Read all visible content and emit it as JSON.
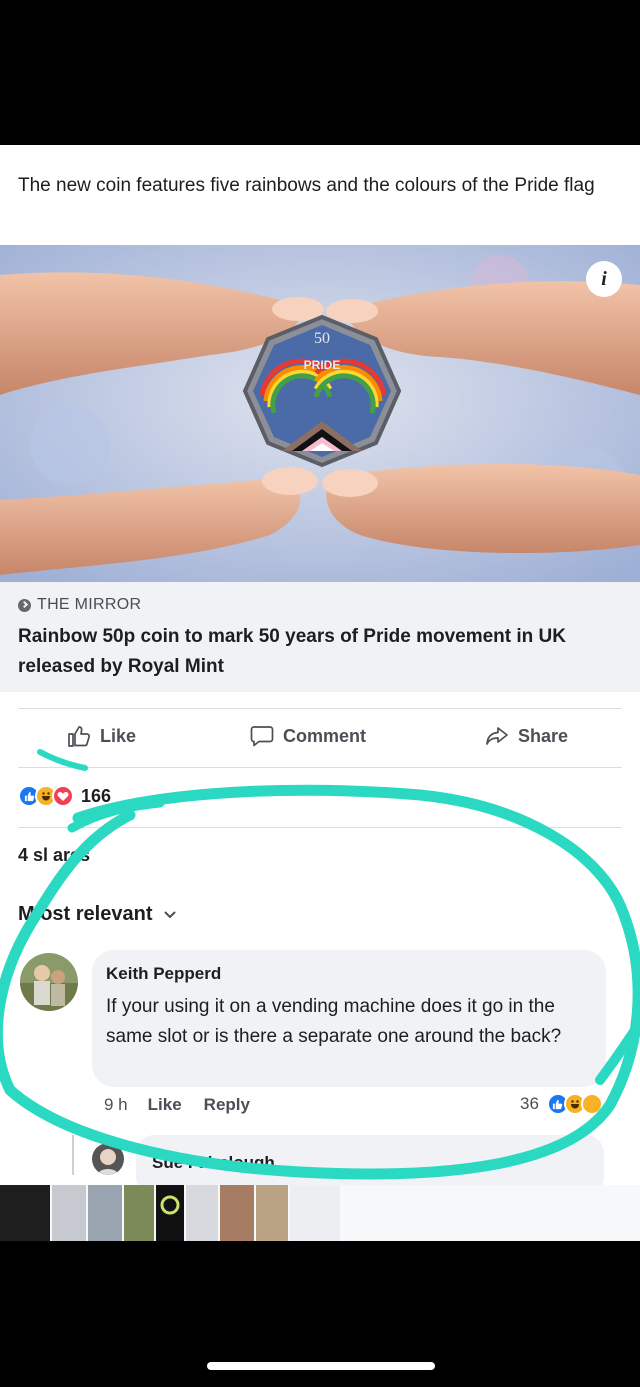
{
  "post": {
    "caption": "The new coin features five rainbows and the colours of the Pride flag",
    "link": {
      "source": "THE MIRROR",
      "headline": "Rainbow 50p coin to mark 50 years of Pride movement in UK released by Royal Mint",
      "image_icon": "info-icon",
      "coin_text": {
        "denomination": "50",
        "word": "PRIDE"
      }
    }
  },
  "actions": {
    "like": "Like",
    "comment": "Comment",
    "share": "Share"
  },
  "reactions": {
    "icons": [
      "like-reaction-icon",
      "haha-reaction-icon",
      "love-reaction-icon"
    ],
    "count": "166"
  },
  "shares": "4 sl ares",
  "sort": {
    "label": "M ost relevant"
  },
  "comments": [
    {
      "author": "Keith Pepperd",
      "text": "If your using it on a vending machine does it go in the same slot or is there a separate one around the back?",
      "time": "9 h",
      "like": "Like",
      "reply": "Reply",
      "reaction_count": "36"
    }
  ],
  "reply": {
    "author": "Sue Fairclough"
  },
  "colors": {
    "annotation": "#2bd9c2",
    "fb_blue": "#1877f2",
    "bubble": "#f0f2f5",
    "text": "#1c1e21",
    "secondary": "#4b4f56"
  }
}
